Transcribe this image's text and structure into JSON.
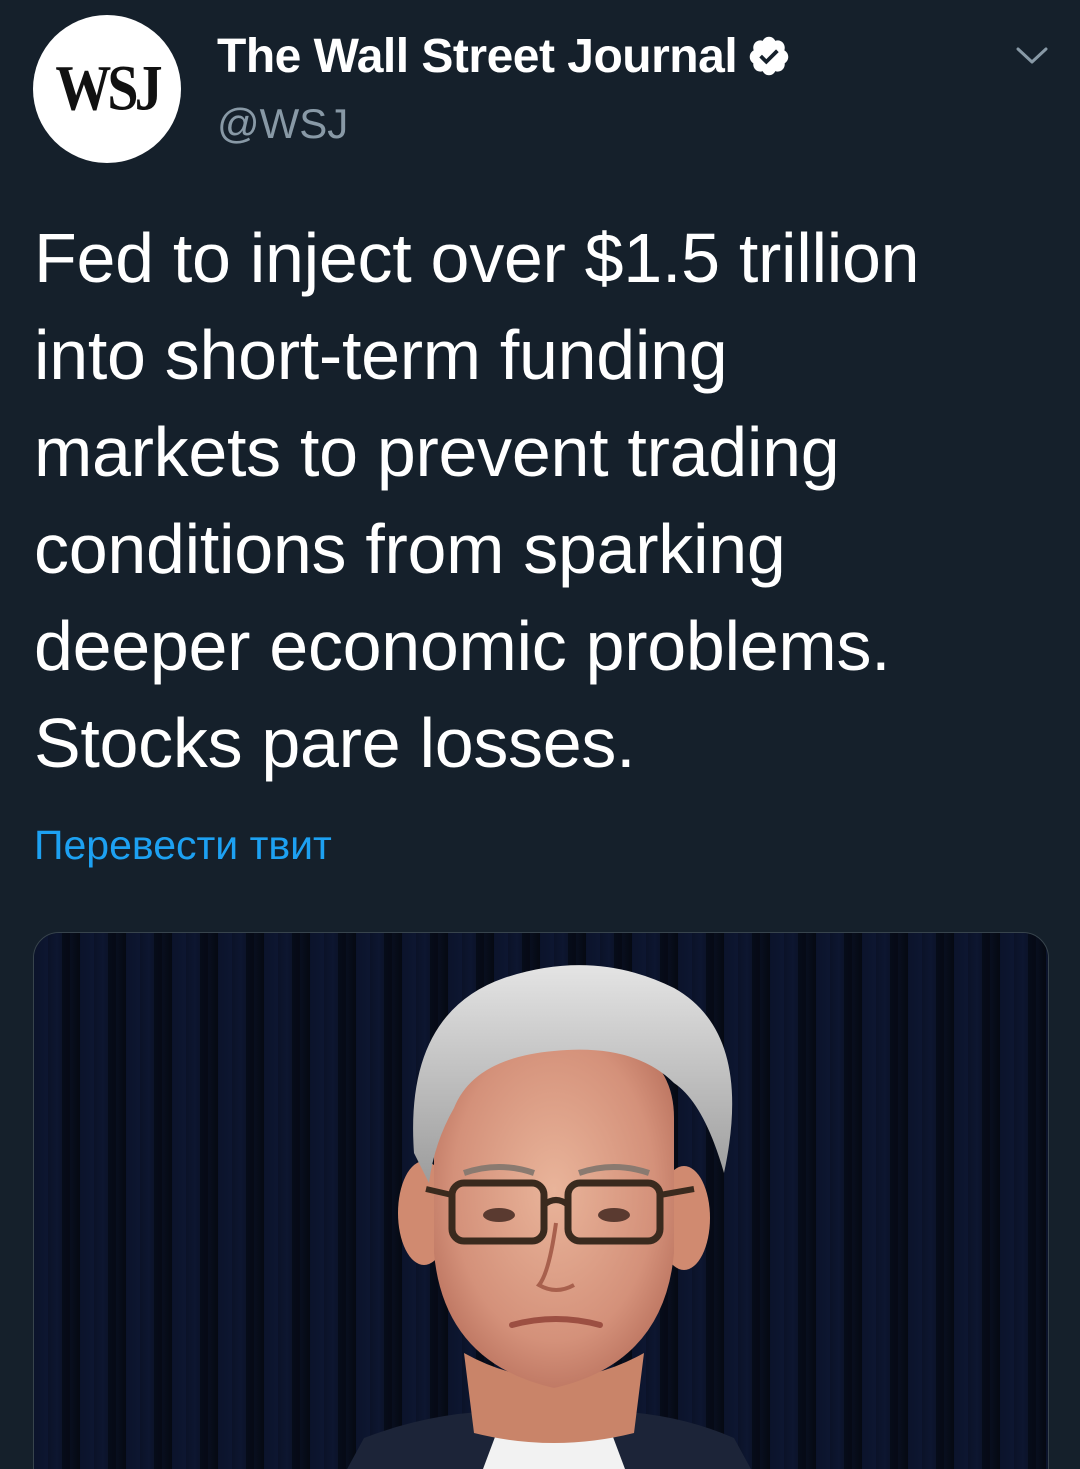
{
  "author": {
    "avatar_text": "WSJ",
    "display_name": "The Wall Street Journal",
    "handle": "@WSJ",
    "verified": true
  },
  "tweet": {
    "text_lines": [
      "Fed to inject over $1.5 trillion",
      "into short-term funding",
      "markets to prevent trading",
      "conditions from sparking",
      "deeper economic problems.",
      "Stocks pare losses."
    ],
    "translate_label": "Перевести твит"
  },
  "media": {
    "type": "photo"
  },
  "colors": {
    "background": "#15202b",
    "text_primary": "#ffffff",
    "text_secondary": "#8899a6",
    "link": "#1da1f2",
    "border": "#38444d"
  },
  "icons": {
    "verified": "verified-badge-icon",
    "menu": "chevron-down-icon"
  }
}
